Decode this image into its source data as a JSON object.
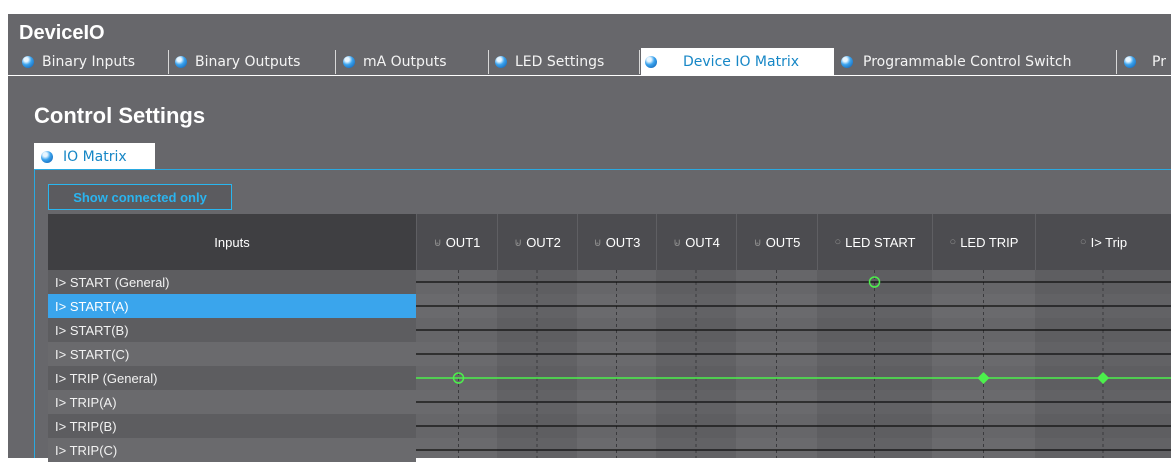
{
  "app": {
    "title": "DeviceIO"
  },
  "tabs": [
    {
      "label": "Binary Inputs",
      "active": false
    },
    {
      "label": "Binary Outputs",
      "active": false
    },
    {
      "label": "mA Outputs",
      "active": false
    },
    {
      "label": "LED Settings",
      "active": false
    },
    {
      "label": "Device IO Matrix",
      "active": true
    },
    {
      "label": "Programmable Control Switch",
      "active": false
    },
    {
      "label": "Pr",
      "active": false
    }
  ],
  "section": {
    "title": "Control Settings"
  },
  "subtab": {
    "label": "IO Matrix"
  },
  "filter": {
    "show_connected_label": "Show connected only"
  },
  "matrix": {
    "inputs_header": "Inputs",
    "columns": [
      "OUT1",
      "OUT2",
      "OUT3",
      "OUT4",
      "OUT5",
      "LED START",
      "LED TRIP",
      "I> Trip"
    ],
    "rows": [
      "I> START (General)",
      "I> START(A)",
      "I> START(B)",
      "I> START(C)",
      "I> TRIP (General)",
      "I> TRIP(A)",
      "I> TRIP(B)",
      "I> TRIP(C)"
    ],
    "selected_row": 1,
    "connections": [
      {
        "row": 0,
        "column": 5,
        "marker": "hollow"
      },
      {
        "row": 4,
        "column": 0,
        "marker": "hollow"
      },
      {
        "row": 4,
        "column": 6,
        "marker": "filled"
      },
      {
        "row": 4,
        "column": 7,
        "marker": "filled"
      }
    ],
    "active_row": 4
  },
  "colors": {
    "accent": "#2aa9e0",
    "selection": "#3aa5ec",
    "connection": "#4cf04c",
    "panel": "#67676b"
  }
}
